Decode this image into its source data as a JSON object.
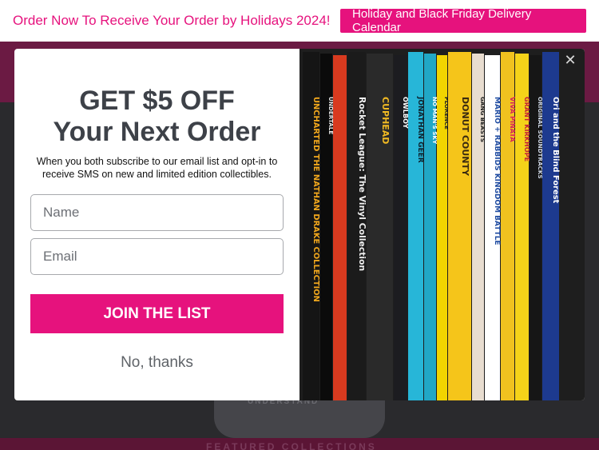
{
  "banner": {
    "promo_text": "Order Now To Receive Your Order by Holidays 2024!",
    "calendar_button": "Holiday and Black Friday Delivery Calendar"
  },
  "colors": {
    "brand_pink": "#e6127d",
    "nav_band": "#6b1a43",
    "title_gray": "#3d4148"
  },
  "modal": {
    "headline_line1": "GET $5 OFF",
    "headline_line2": "Your Next Order",
    "subtitle": "When you both subscribe to our email list and opt-in to receive SMS on new and limited edition collectibles.",
    "name_placeholder": "Name",
    "email_placeholder": "Email",
    "join_label": "JOIN THE LIST",
    "decline_label": "No, thanks",
    "close_icon": "close-icon"
  },
  "records": [
    {
      "title": "UNCHARTED THE NATHAN DRAKE COLLECTION",
      "color": "#151515",
      "text": "#f2a81d"
    },
    {
      "title": "UNDERTALE",
      "color": "#0b0b0b",
      "text": "#e8e8e8"
    },
    {
      "title": "",
      "color": "#d83a1f",
      "text": "#ffffff"
    },
    {
      "title": "Rocket League: The Vinyl Collection",
      "color": "#1b1b1b",
      "text": "#f0f0f0"
    },
    {
      "title": "CUPHEAD",
      "color": "#2a2a2a",
      "text": "#f0b923"
    },
    {
      "title": "OWLBOY",
      "color": "#1c1c20",
      "text": "#ffffff"
    },
    {
      "title": "JONATHAN GEER",
      "color": "#27b6d8",
      "text": "#0c2330"
    },
    {
      "title": "NO MAN'S SKY",
      "color": "#21a7c6",
      "text": "#ffffff"
    },
    {
      "title": "FLORENCE",
      "color": "#f2d400",
      "text": "#222222"
    },
    {
      "title": "DONUT COUNTY",
      "color": "#f5c51a",
      "text": "#3a2a10"
    },
    {
      "title": "GANG BEASTS",
      "color": "#e8ddd0",
      "text": "#1a1a1a"
    },
    {
      "title": "MARIO + RABBIDS KINGDOM BATTLE",
      "color": "#ffffff",
      "text": "#1d4aa0"
    },
    {
      "title": "VIVA PINATA",
      "color": "#f0c21f",
      "text": "#d8235a"
    },
    {
      "title": "GRANT KIRKHOPE",
      "color": "#f5d319",
      "text": "#c21f3a"
    },
    {
      "title": "ORIGINAL SOUNDTRACKS",
      "color": "#161616",
      "text": "#cfd8e6"
    },
    {
      "title": "Ori and the Blind Forest",
      "color": "#1d3a8f",
      "text": "#ffffff"
    }
  ],
  "background": {
    "center_label": "UNDERSTAND",
    "bottom_label": "FEATURED COLLECTIONS"
  }
}
